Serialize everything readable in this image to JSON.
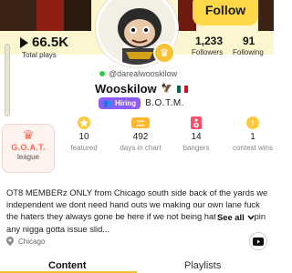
{
  "header": {
    "follow_label": "Follow"
  },
  "profile": {
    "handle": "@darealwooskilow",
    "display_name": "Wooskilow",
    "hiring_label": "Hiring",
    "tagline": "B.O.T.M."
  },
  "stats": {
    "plays_value": "66.5K",
    "plays_label": "Total plays",
    "followers_value": "1,233",
    "followers_label": "Followers",
    "following_value": "91",
    "following_label": "Following"
  },
  "achievements": [
    {
      "title": "G.O.A.T.",
      "label": "league",
      "icon": "crown-icon"
    },
    {
      "value": "10",
      "label": "featured",
      "icon": "star-icon"
    },
    {
      "value": "492",
      "label": "days in chart",
      "icon": "top-1000-icon"
    },
    {
      "value": "14",
      "label": "bangers",
      "icon": "speaker-icon"
    },
    {
      "value": "1",
      "label": "contest wins",
      "icon": "medal-icon"
    }
  ],
  "bio": {
    "text": "OT8 MEMBERz ONLY from Chicago south side back of the yards we independent we dont need hand outs we making our own lane fuck the haters they always gone be here if we not being hated we slippin any nigga gotta issue slid...",
    "see_all": "See all"
  },
  "location": "Chicago",
  "tabs": [
    {
      "label": "Content",
      "active": true
    },
    {
      "label": "Playlists",
      "active": false
    }
  ],
  "colors": {
    "accent": "#f7c232",
    "follow_button": "#ffd84a",
    "hiring": "#8b5cf6",
    "goat": "#ff6a4d",
    "online": "#2ecc40"
  }
}
